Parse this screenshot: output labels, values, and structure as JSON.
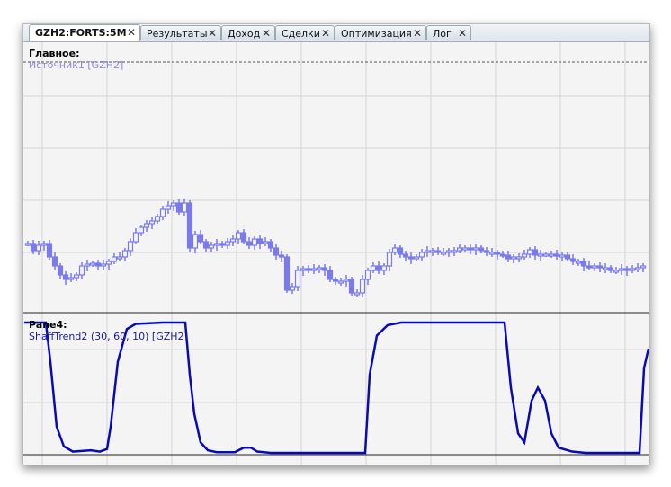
{
  "tabs": [
    {
      "label": "GZH2:FORTS:5M",
      "active": true
    },
    {
      "label": "Результаты"
    },
    {
      "label": "Доход"
    },
    {
      "label": "Сделки"
    },
    {
      "label": "Оптимизация"
    },
    {
      "label": "Лог"
    }
  ],
  "close_glyph": "✕",
  "main_pane": {
    "title": "Главное:",
    "series_label": "Источник1 [GZH2]",
    "candle_color": "#7b7be8"
  },
  "indicator_pane": {
    "title": "Pane4:",
    "series_label": "ShaffTrend2 (30, 60, 10) [GZH2]",
    "line_color": "#0a0ab4"
  },
  "chart_data": [
    {
      "type": "candlestick",
      "name": "Источник1 [GZH2]",
      "note": "relative price units",
      "closes": [
        77,
        69,
        75,
        77,
        62,
        52,
        42,
        37,
        39,
        42,
        52,
        54,
        55,
        52,
        54,
        57,
        62,
        62,
        69,
        79,
        89,
        95,
        99,
        102,
        107,
        115,
        119,
        122,
        112,
        122,
        72,
        87,
        79,
        72,
        75,
        77,
        75,
        79,
        82,
        89,
        79,
        75,
        82,
        77,
        79,
        72,
        64,
        62,
        25,
        29,
        47,
        49,
        47,
        49,
        50,
        47,
        37,
        35,
        35,
        37,
        22,
        22,
        37,
        47,
        52,
        47,
        52,
        67,
        72,
        65,
        62,
        60,
        62,
        67,
        69,
        69,
        67,
        67,
        69,
        69,
        72,
        72,
        70,
        72,
        69,
        67,
        67,
        65,
        64,
        60,
        62,
        62,
        65,
        70,
        64,
        65,
        65,
        65,
        64,
        64,
        60,
        57,
        57,
        52,
        50,
        52,
        50,
        50,
        47,
        47,
        49,
        47,
        49,
        50,
        52
      ]
    },
    {
      "type": "line",
      "name": "ShaffTrend2 (30, 60, 10) [GZH2]",
      "ylim": [
        0,
        100
      ],
      "points": [
        [
          0,
          100
        ],
        [
          24,
          100
        ],
        [
          29,
          70
        ],
        [
          36,
          20
        ],
        [
          44,
          5
        ],
        [
          54,
          1
        ],
        [
          64,
          1.5
        ],
        [
          74,
          2
        ],
        [
          84,
          1
        ],
        [
          92,
          3
        ],
        [
          96,
          20
        ],
        [
          104,
          70
        ],
        [
          114,
          95
        ],
        [
          124,
          99
        ],
        [
          154,
          100
        ],
        [
          179,
          100
        ],
        [
          184,
          60
        ],
        [
          189,
          30
        ],
        [
          196,
          8
        ],
        [
          204,
          2
        ],
        [
          214,
          0.5
        ],
        [
          234,
          0.5
        ],
        [
          244,
          4
        ],
        [
          252,
          4
        ],
        [
          259,
          1
        ],
        [
          274,
          0
        ],
        [
          379,
          0
        ],
        [
          384,
          60
        ],
        [
          392,
          90
        ],
        [
          404,
          98
        ],
        [
          419,
          100
        ],
        [
          534,
          100
        ],
        [
          541,
          50
        ],
        [
          549,
          15
        ],
        [
          556,
          8
        ],
        [
          564,
          40
        ],
        [
          571,
          50
        ],
        [
          579,
          40
        ],
        [
          586,
          15
        ],
        [
          594,
          4
        ],
        [
          609,
          1
        ],
        [
          624,
          0
        ],
        [
          684,
          0
        ],
        [
          689,
          65
        ],
        [
          694,
          80
        ]
      ]
    }
  ]
}
